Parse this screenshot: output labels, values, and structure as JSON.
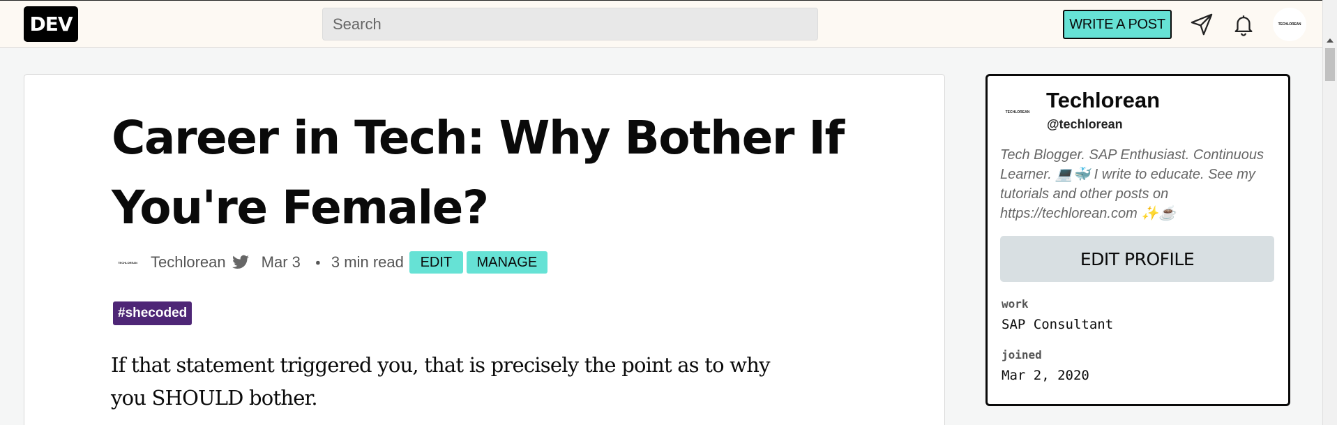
{
  "nav": {
    "logo": "DEV",
    "search_placeholder": "Search",
    "write_post": "WRITE A POST",
    "avatar_text": "TECHLOREAN"
  },
  "article": {
    "title": "Career in Tech: Why Bother If You're Female?",
    "author": "Techlorean",
    "avatar_text": "TECHLOREAN",
    "date": "Mar 3",
    "separator": "・",
    "read_time": "3 min read",
    "edit_label": "EDIT",
    "manage_label": "MANAGE",
    "tag": "#shecoded",
    "body": "If that statement triggered you, that is precisely the point as to why you SHOULD bother."
  },
  "profile": {
    "avatar_text": "TECHLOREAN",
    "name": "Techlorean",
    "handle": "@techlorean",
    "bio": "Tech Blogger. SAP Enthusiast. Continuous Learner. 💻🐳 I write to educate. See my tutorials and other posts on https://techlorean.com ✨☕",
    "edit_profile": "EDIT PROFILE",
    "work_label": "work",
    "work_value": "SAP Consultant",
    "joined_label": "joined",
    "joined_value": "Mar 2, 2020"
  },
  "colors": {
    "accent": "#66e2d5",
    "tag_bg": "#4e2676",
    "nav_bg": "#fdf9f3"
  },
  "icons": [
    "send-icon",
    "bell-icon",
    "twitter-icon"
  ]
}
